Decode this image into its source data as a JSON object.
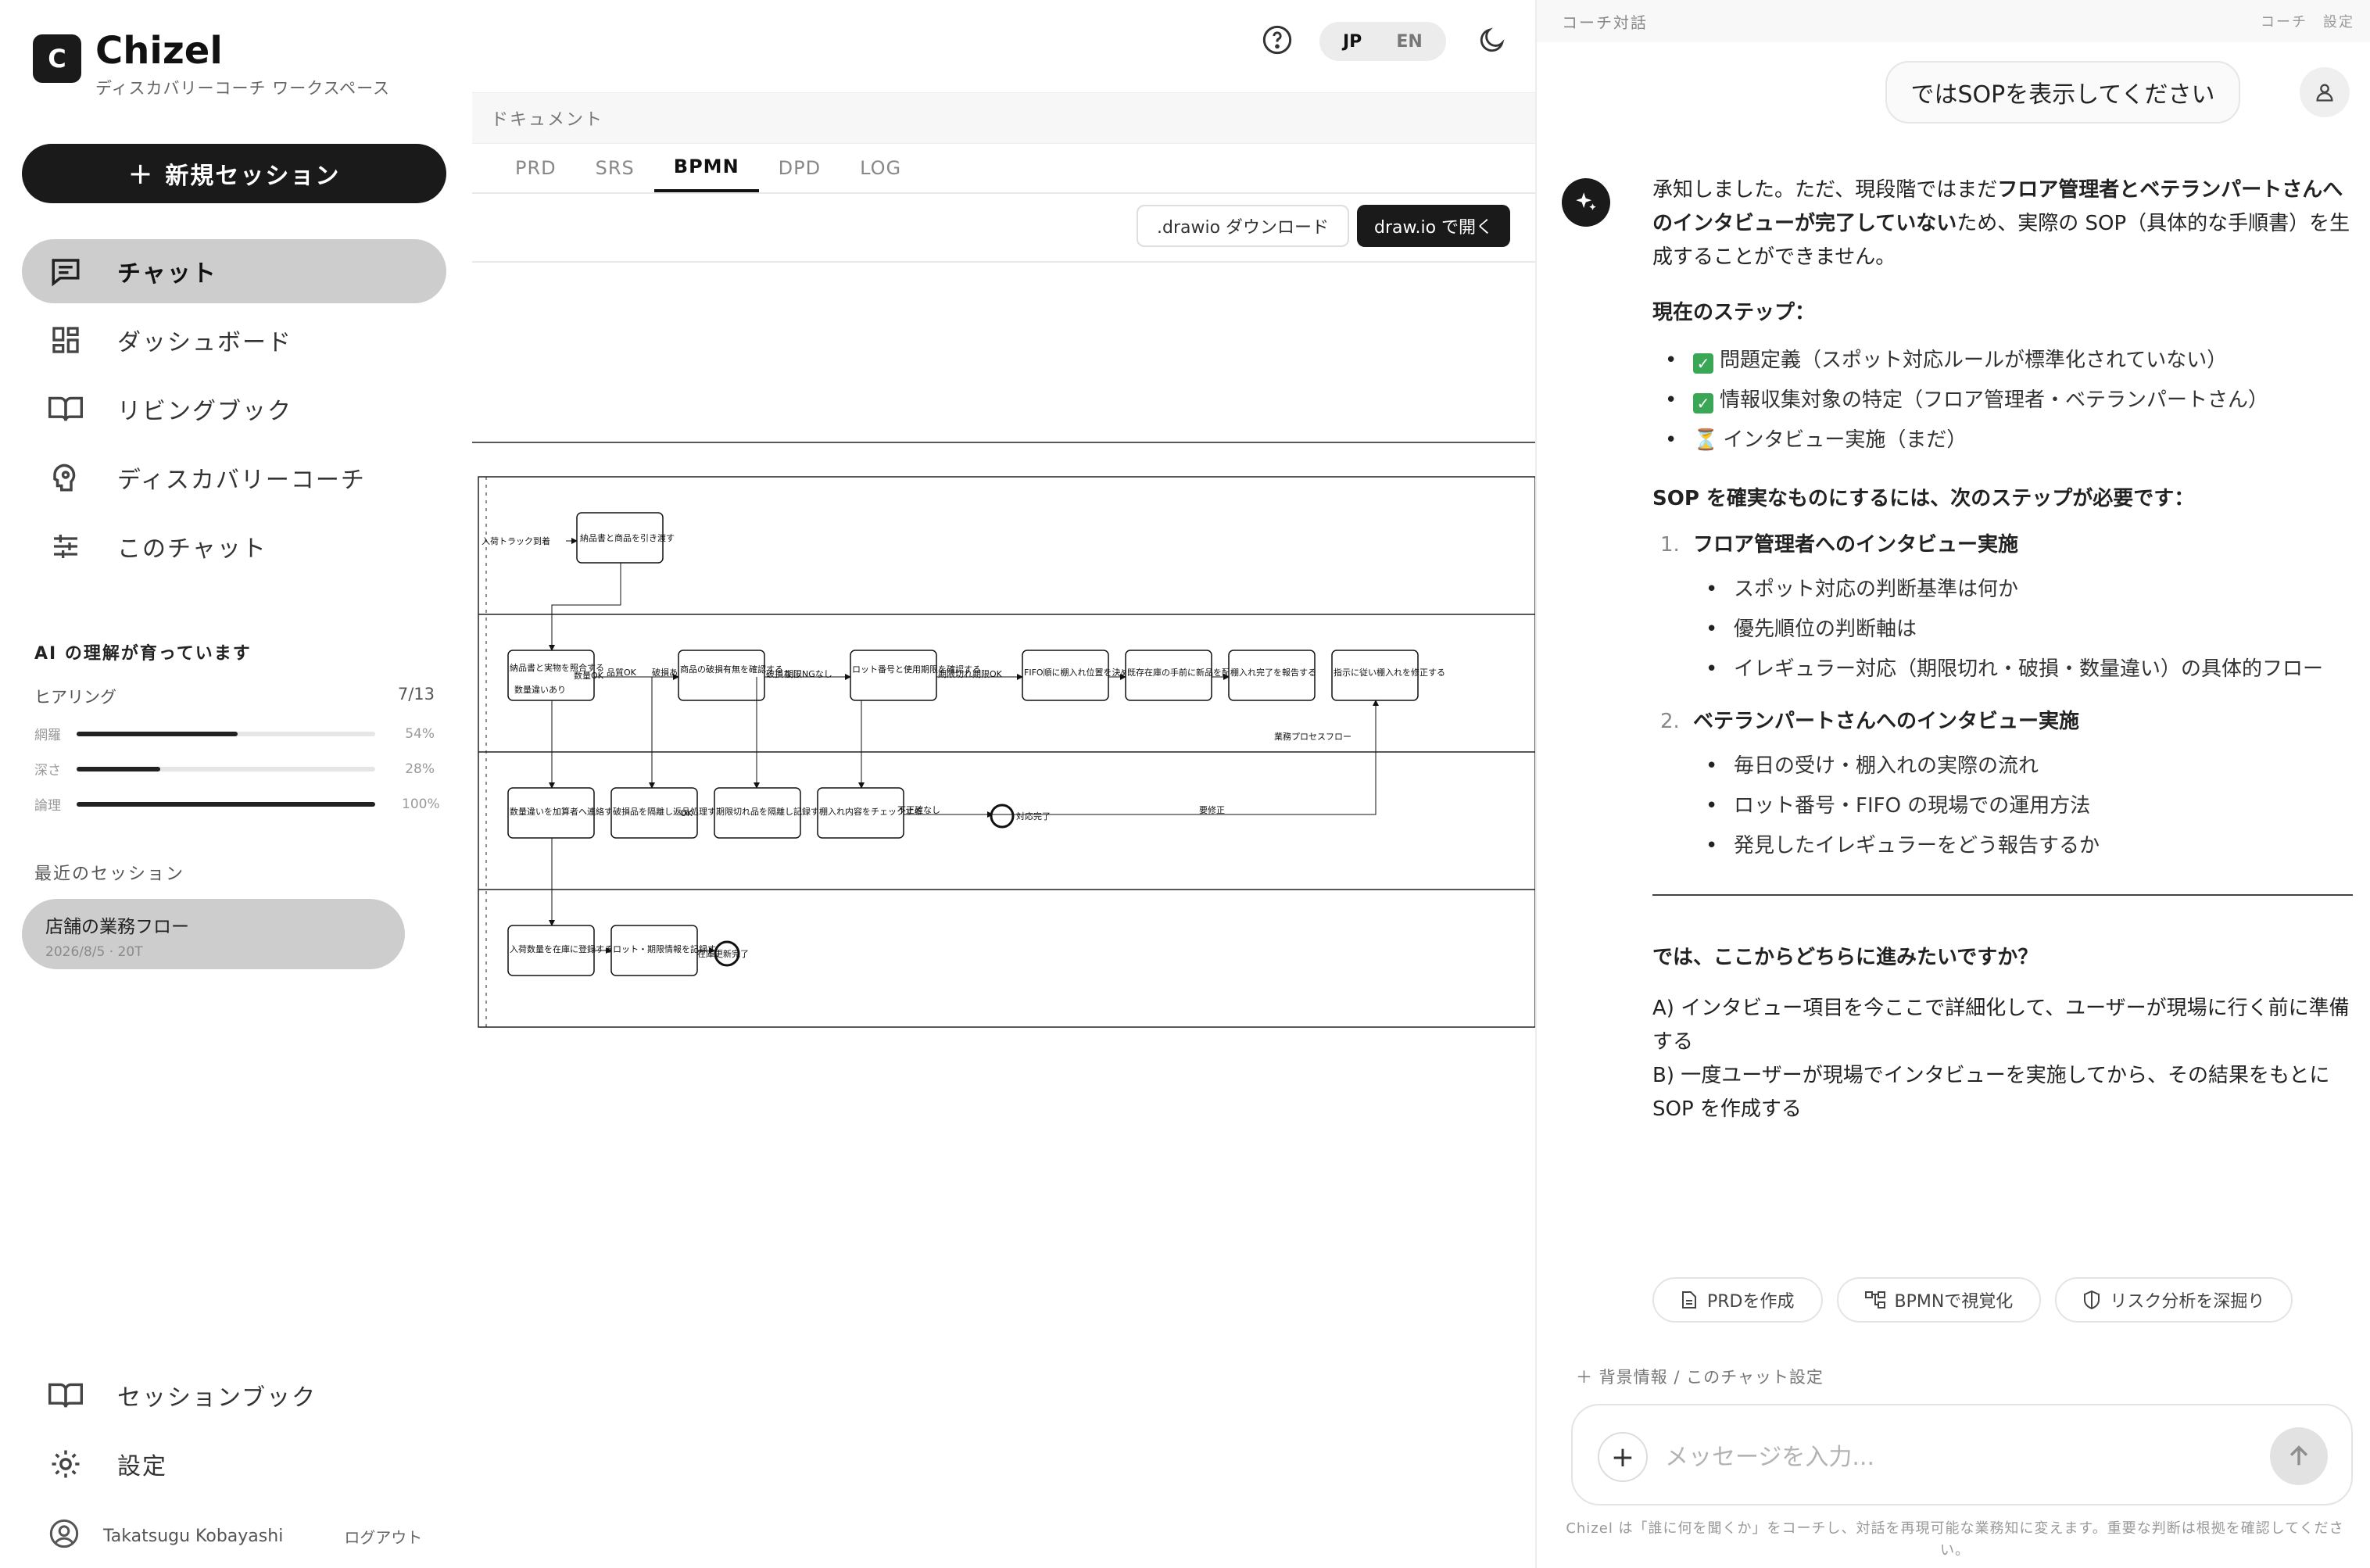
{
  "brand": {
    "logo_letter": "C",
    "name": "Chizel",
    "subtitle": "ディスカバリーコーチ ワークスペース"
  },
  "sidebar": {
    "new_session": "新規セッション",
    "nav": [
      {
        "label": "チャット",
        "icon": "chat-icon",
        "active": true
      },
      {
        "label": "ダッシュボード",
        "icon": "dashboard-icon"
      },
      {
        "label": "リビングブック",
        "icon": "book-icon"
      },
      {
        "label": "ディスカバリーコーチ",
        "icon": "coach-icon"
      },
      {
        "label": "このチャット",
        "icon": "sliders-icon"
      }
    ],
    "ai": {
      "title": "AI の理解が育っています",
      "hearing_label": "ヒアリング",
      "hearing_count": "7/13",
      "metrics": [
        {
          "label": "網羅",
          "percent": "54%",
          "value": 54
        },
        {
          "label": "深さ",
          "percent": "28%",
          "value": 28
        },
        {
          "label": "論理",
          "percent": "100%",
          "value": 100
        }
      ]
    },
    "recent_title": "最近のセッション",
    "recent": [
      {
        "title": "店舗の業務フロー",
        "date": "2026/8/5 · 20T"
      }
    ],
    "bottom_nav": [
      {
        "label": "セッションブック",
        "icon": "book-icon"
      },
      {
        "label": "設定",
        "icon": "gear-icon"
      }
    ],
    "user": {
      "name": "Takatsugu Kobayashi",
      "logout": "ログアウト"
    }
  },
  "center": {
    "lang_jp": "JP",
    "lang_en": "EN",
    "doc_header": "ドキュメント",
    "tabs": [
      "PRD",
      "SRS",
      "BPMN",
      "DPD",
      "LOG"
    ],
    "active_tab": "BPMN",
    "download_label": ".drawio ダウンロード",
    "open_label": "draw.io で開く",
    "diagram": {
      "lane1": [
        "入荷トラック到着",
        "納品書と商品を引き渡す"
      ],
      "lane2": [
        "納品書と実物を照合する",
        "数量違いあり",
        "数量OK",
        "品質OK",
        "破損あり",
        "商品の破損有無を確認する",
        "破損なし",
        "期限NGなし",
        "ロット番号と使用期限を確認する",
        "期限切れ",
        "期限OK",
        "FIFO順に棚入れ位置を決める",
        "既存在庫の手前に新品を配置する",
        "棚入れ完了を報告する",
        "指示に従い棚入れを修正する",
        "業務プロセスフロー"
      ],
      "lane3": [
        "数量違いを加算者へ連絡する",
        "破損品を隔離し返品処理する",
        "OK",
        "期限切れ品を隔離し記録する",
        "棚入れ内容をチェックする",
        "不正確なし",
        "対応完了",
        "要修正"
      ],
      "lane4": [
        "入荷数量を在庫に登録する",
        "ロット・期限情報を記録する",
        "在庫更新完了"
      ]
    }
  },
  "chat": {
    "header": "コーチ対話",
    "header_right": "コーチ　設定",
    "user_message": "ではSOPを表示してください",
    "intro_1": "承知しました。ただ、現段階ではまだ",
    "intro_bold": "フロア管理者とベテランパートさんへのインタビューが完了していない",
    "intro_2": "ため、実際の SOP（具体的な手順書）を生成することができません。",
    "steps_title": "現在のステップ：",
    "steps": [
      {
        "mark": "done",
        "text": "問題定義（スポット対応ルールが標準化されていない）"
      },
      {
        "mark": "done",
        "text": "情報収集対象の特定（フロア管理者・ベテランパートさん）"
      },
      {
        "mark": "pending",
        "text": "インタビュー実施（まだ）"
      }
    ],
    "next_title": "SOP を確実なものにするには、次のステップが必要です：",
    "next_steps": [
      {
        "num": "1.",
        "head": "フロア管理者へのインタビュー実施",
        "items": [
          "スポット対応の判断基準は何か",
          "優先順位の判断軸は",
          "イレギュラー対応（期限切れ・破損・数量違い）の具体的フロー"
        ]
      },
      {
        "num": "2.",
        "head": "ベテランパートさんへのインタビュー実施",
        "items": [
          "毎日の受け・棚入れの実際の流れ",
          "ロット番号・FIFO の現場での運用方法",
          "発見したイレギュラーをどう報告するか"
        ]
      }
    ],
    "question": "では、ここからどちらに進みたいですか？",
    "option_a": "A) インタビュー項目を今ここで詳細化して、ユーザーが現場に行く前に準備する",
    "option_b": "B) 一度ユーザーが現場でインタビューを実施してから、その結果をもとに SOP を作成する",
    "chips": [
      {
        "label": "PRDを作成",
        "icon": "document-icon"
      },
      {
        "label": "BPMNで視覚化",
        "icon": "flow-icon"
      },
      {
        "label": "リスク分析を深掘り",
        "icon": "shield-icon"
      }
    ],
    "context_link": "＋ 背景情報 / このチャット設定",
    "input_placeholder": "メッセージを入力...",
    "disclaimer": "Chizel は「誰に何を聞くか」をコーチし、対話を再現可能な業務知に変えます。重要な判断は根拠を確認してください。"
  }
}
